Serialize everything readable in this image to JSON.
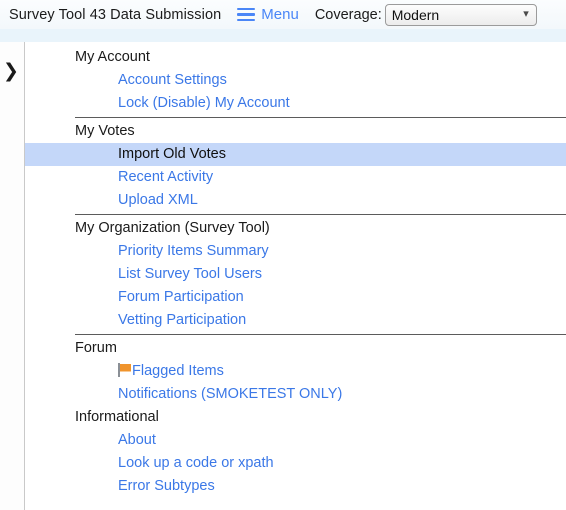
{
  "header": {
    "app_title": "Survey Tool 43 Data Submission",
    "menu_label": "Menu",
    "menu_icon": "hamburger-icon",
    "coverage_label": "Coverage:",
    "coverage_value": "Modern",
    "coverage_options": [
      "Modern"
    ],
    "select_chevron_icon": "chevron-down-icon"
  },
  "rail": {
    "expand_icon": "chevron-right-icon",
    "expand_glyph": "❯"
  },
  "menu": {
    "sections": [
      {
        "title": "My Account",
        "separator_above": false,
        "items": [
          {
            "label": "Account Settings",
            "selected": false,
            "icon": null
          },
          {
            "label": "Lock (Disable) My Account",
            "selected": false,
            "icon": null
          }
        ]
      },
      {
        "title": "My Votes",
        "separator_above": true,
        "items": [
          {
            "label": "Import Old Votes",
            "selected": true,
            "icon": null
          },
          {
            "label": "Recent Activity",
            "selected": false,
            "icon": null
          },
          {
            "label": "Upload XML",
            "selected": false,
            "icon": null
          }
        ]
      },
      {
        "title": "My Organization (Survey Tool)",
        "separator_above": true,
        "items": [
          {
            "label": "Priority Items Summary",
            "selected": false,
            "icon": null
          },
          {
            "label": "List Survey Tool Users",
            "selected": false,
            "icon": null
          },
          {
            "label": "Forum Participation",
            "selected": false,
            "icon": null
          },
          {
            "label": "Vetting Participation",
            "selected": false,
            "icon": null
          }
        ]
      },
      {
        "title": "Forum",
        "separator_above": true,
        "items": [
          {
            "label": "Flagged Items",
            "selected": false,
            "icon": "flag-icon"
          },
          {
            "label": "Notifications (SMOKETEST ONLY)",
            "selected": false,
            "icon": null
          }
        ]
      },
      {
        "title": "Informational",
        "separator_above": false,
        "items": [
          {
            "label": "About",
            "selected": false,
            "icon": null
          },
          {
            "label": "Look up a code or xpath",
            "selected": false,
            "icon": null
          },
          {
            "label": "Error Subtypes",
            "selected": false,
            "icon": null
          }
        ]
      }
    ]
  },
  "colors": {
    "link": "#3b78e7",
    "accent": "#4a86f7",
    "selected_bg": "#c4d7f9",
    "strip": "#e9f4fb",
    "flag": "#f0942c"
  }
}
